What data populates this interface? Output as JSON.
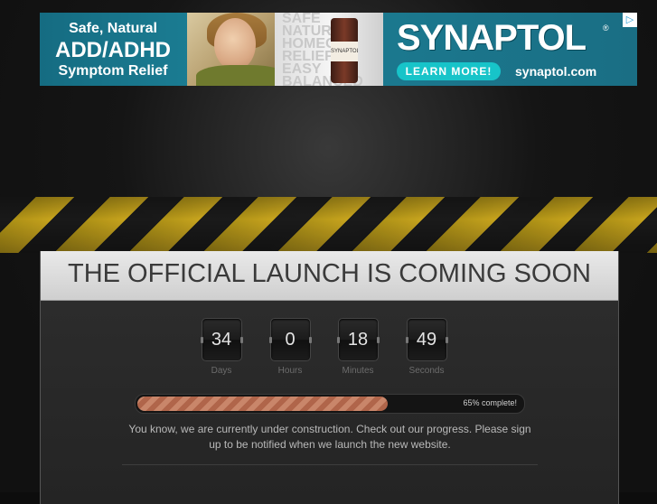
{
  "ad": {
    "line1": "Safe, Natural",
    "line2": "ADD/ADHD",
    "line3": "Symptom Relief",
    "mid_text": [
      "SAFE",
      "NATURAL",
      "HOMEOP.",
      "RELIEF",
      "EASY",
      "BALANCED"
    ],
    "bottle_label": "SYNAPTOL",
    "brand": "SYNAPTOL",
    "reg_mark": "®",
    "cta": "LEARN MORE!",
    "url": "synaptol.com",
    "choices_icon": "▷"
  },
  "panel": {
    "title": "THE OFFICIAL LAUNCH IS COMING SOON",
    "countdown": [
      {
        "value": "34",
        "label": "Days"
      },
      {
        "value": "0",
        "label": "Hours"
      },
      {
        "value": "18",
        "label": "Minutes"
      },
      {
        "value": "49",
        "label": "Seconds"
      }
    ],
    "progress": {
      "percent": 65,
      "text": "65% complete!"
    },
    "description": "You know, we are currently under construction. Check out our progress. Please sign up to be notified when we launch the new website."
  }
}
